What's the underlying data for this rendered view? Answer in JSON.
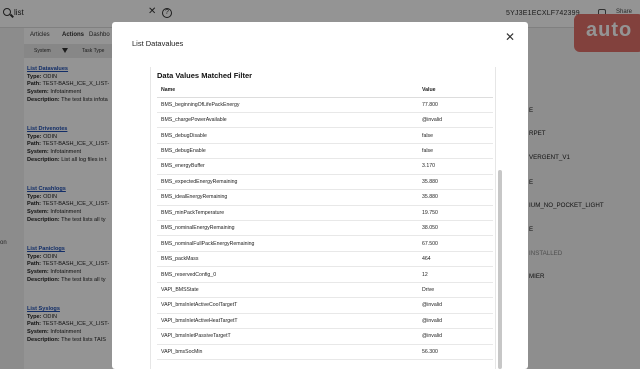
{
  "topbar": {
    "search_value": "list",
    "clear_symbol": "✕",
    "help_symbol": "?",
    "vin": "5YJ3E1ECXLF742399",
    "share_label": "Share",
    "brand": "auto"
  },
  "tabs": [
    "Articles",
    "Actions",
    "Dashbo"
  ],
  "filterbar": {
    "system_label": "System",
    "task_type_label": "Task Type"
  },
  "left_items": [
    {
      "title": "List Datavalues",
      "type": "ODIN",
      "path": "TEST-BASH_ICE_X_LIST-",
      "system": "Infotainment",
      "description": "The test lists infota"
    },
    {
      "title": "List Drivenotes",
      "type": "ODIN",
      "path": "TEST-BASH_ICE_X_LIST-",
      "system": "Infotainment",
      "description": "List all log files in t"
    },
    {
      "title": "List Crashlogs",
      "type": "ODIN",
      "path": "TEST-BASH_ICE_X_LIST-",
      "system": "Infotainment",
      "description": "The test lists all ty"
    },
    {
      "title": "List Paniclogs",
      "type": "ODIN",
      "path": "TEST-BASH_ICE_X_LIST-",
      "system": "Infotainment",
      "description": "The test lists all ty"
    },
    {
      "title": "List Syslogs",
      "type": "ODIN",
      "path": "TEST-BASH_ICE_X_LIST-",
      "system": "Infotainment",
      "description": "The test lists TAIS"
    }
  ],
  "labels": {
    "type": "Type:",
    "path": "Path:",
    "system": "System:",
    "description": "Description:"
  },
  "left_edge_text": "on",
  "right_panel_labels": [
    "E",
    "RPET",
    "VERGENT_V1",
    "E",
    "IUM_NO_POCKET_LIGHT",
    "E",
    "INSTALLED",
    "MIER"
  ],
  "modal": {
    "title": "List Datavalues",
    "close_symbol": "✕",
    "card_title": "Data Values Matched Filter",
    "columns": {
      "name": "Name",
      "value": "Value"
    },
    "rows": [
      {
        "name": "BMS_beginningOfLifePackEnergy",
        "value": "77.800"
      },
      {
        "name": "BMS_chargePowerAvailable",
        "value": "@invalid"
      },
      {
        "name": "BMS_debugDisable",
        "value": "false"
      },
      {
        "name": "BMS_debugEnable",
        "value": "false"
      },
      {
        "name": "BMS_energyBuffer",
        "value": "3.170"
      },
      {
        "name": "BMS_expectedEnergyRemaining",
        "value": "35.880"
      },
      {
        "name": "BMS_idealEnergyRemaining",
        "value": "35.880"
      },
      {
        "name": "BMS_minPackTemperature",
        "value": "19.750"
      },
      {
        "name": "BMS_nominalEnergyRemaining",
        "value": "38.050"
      },
      {
        "name": "BMS_nominalFullPackEnergyRemaining",
        "value": "67.500"
      },
      {
        "name": "BMS_packMass",
        "value": "464"
      },
      {
        "name": "BMS_reservedConfig_0",
        "value": "12"
      },
      {
        "name": "VAPI_BMSState",
        "value": "Drive"
      },
      {
        "name": "VAPI_bmsInletActiveCoolTargetT",
        "value": "@invalid"
      },
      {
        "name": "VAPI_bmsInletActiveHeatTargetT",
        "value": "@invalid"
      },
      {
        "name": "VAPI_bmsInletPassiveTargetT",
        "value": "@invalid"
      },
      {
        "name": "VAPI_bmsSocMin",
        "value": "56.300"
      }
    ]
  },
  "colors": {
    "accent_link": "#1f4fb3",
    "brand_bg": "#e0706a"
  }
}
